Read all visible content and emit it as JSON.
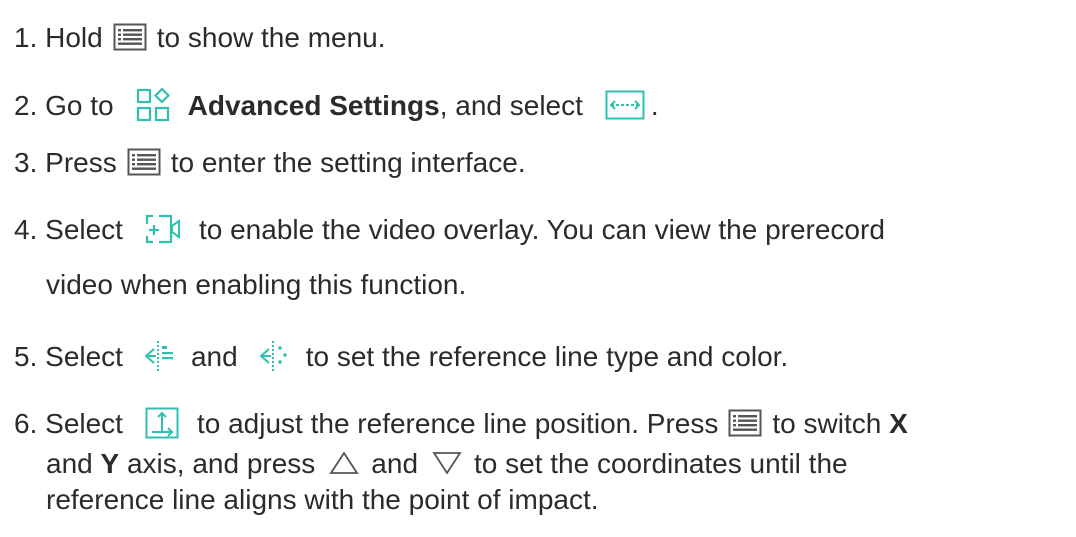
{
  "icons": {
    "menu": "menu-list-icon",
    "advanced_settings": "advanced-settings-icon",
    "zeroing": "zeroing-arrows-icon",
    "video_overlay": "video-overlay-icon",
    "line_type": "reference-line-type-icon",
    "line_color": "reference-line-color-icon",
    "position": "reference-position-icon",
    "up": "up-triangle-icon",
    "down": "down-triangle-icon"
  },
  "colors": {
    "accent": "#2fc0b0",
    "text": "#2b2b2b",
    "icon_gray": "#555555"
  },
  "steps": [
    {
      "num": "1.",
      "a": "Hold",
      "b": "to show the menu."
    },
    {
      "num": "2.",
      "a": "Go to",
      "bold": "Advanced Settings",
      "b": ", and select",
      "c": "."
    },
    {
      "num": "3.",
      "a": "Press",
      "b": "to enter the setting interface."
    },
    {
      "num": "4.",
      "a": "Select",
      "b": "to enable the video overlay. You can view the prerecord",
      "line2": "video when enabling this function."
    },
    {
      "num": "5.",
      "a": "Select",
      "mid": "and",
      "b": "to set the reference line type and color."
    },
    {
      "num": "6.",
      "a": "Select",
      "b": "to adjust the reference line position. Press",
      "c": "to switch",
      "bold_x": "X",
      "line2_a": "and",
      "bold_y": "Y",
      "line2_b": "axis, and press",
      "line2_mid": "and",
      "line2_c": "to set the coordinates until the",
      "line3": "reference line aligns with the point of impact."
    }
  ]
}
